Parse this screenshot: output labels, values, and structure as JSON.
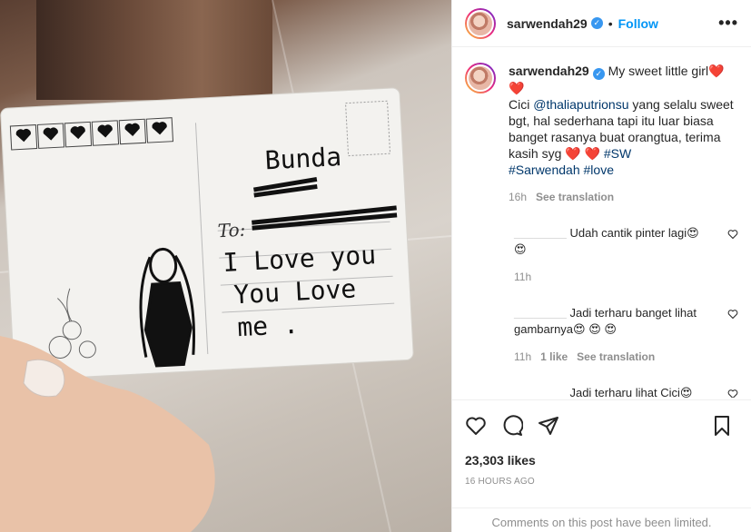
{
  "post": {
    "username": "sarwendah29",
    "follow_label": "Follow",
    "more_label": "•••",
    "dot": "•"
  },
  "caption": {
    "username": "sarwendah29",
    "text_first": "My sweet little girl❤️",
    "line2": "❤️",
    "text_main_a": "Cici ",
    "mention": "@thaliaputrionsu",
    "text_main_b": " yang selalu sweet bgt, hal sederhana tapi itu luar biasa banget rasanya buat orangtua, terima kasih syg ❤️ ❤️ ",
    "hashtag1": "#SW",
    "hashtag2": "#Sarwendah",
    "hashtag3": "#love",
    "time": "16h",
    "see_translation": "See translation"
  },
  "comments": [
    {
      "user": "________",
      "text": "Udah cantik pinter lagi😍",
      "line2": "😍",
      "time": "11h",
      "likes": "",
      "see_translation": ""
    },
    {
      "user": "________",
      "text": "Jadi terharu banget lihat gambarnya😍 😍 😍",
      "line2": "",
      "time": "11h",
      "likes": "1 like",
      "see_translation": "See translation"
    },
    {
      "user": "________",
      "text": "Jadi terharu lihat Cici😍",
      "line2": "😍",
      "time": "",
      "likes": "",
      "see_translation": ""
    }
  ],
  "stats": {
    "likes": "23,303 likes",
    "timestamp": "16 HOURS AGO",
    "limited": "Comments on this post have been limited."
  },
  "postcard": {
    "line1": "Bunda",
    "to_label": "To:",
    "line2": "I Love you",
    "line3": "You Love",
    "line4": "me ."
  },
  "colors": {
    "accent": "#0095f6",
    "verified": "#3897f0",
    "hashtag": "#00376b",
    "muted": "#8e8e8e"
  },
  "icons": [
    "verified-icon",
    "heart-icon",
    "comment-icon",
    "share-icon",
    "bookmark-icon",
    "more-icon"
  ]
}
